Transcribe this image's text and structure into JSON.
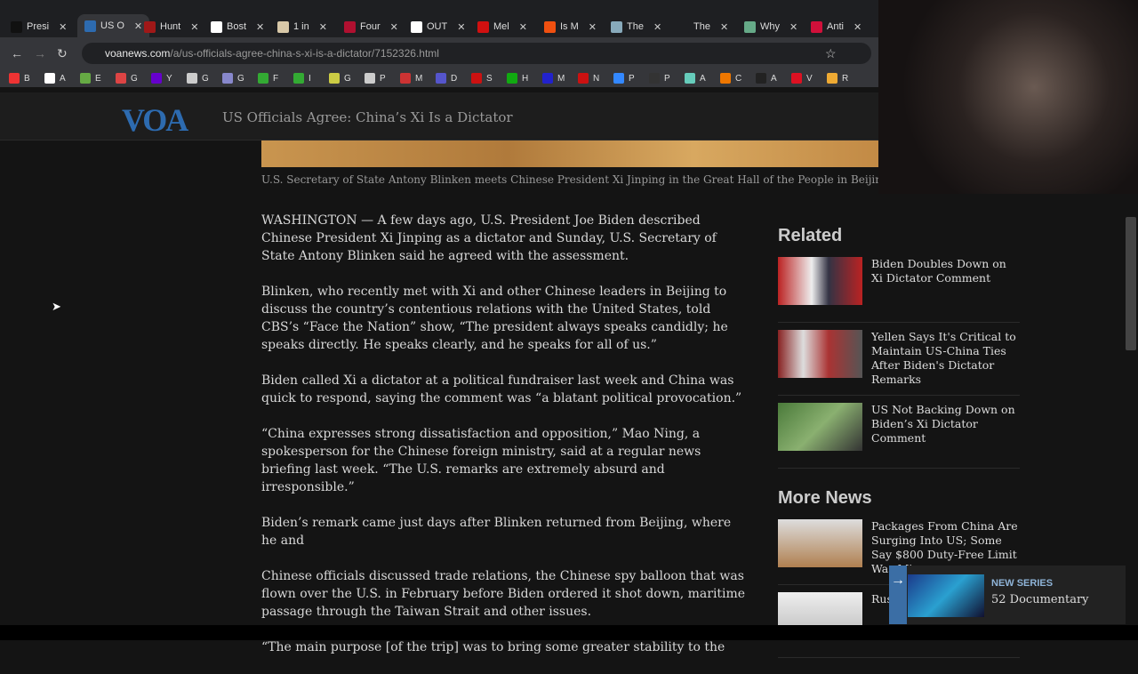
{
  "tabs": [
    {
      "label": "Presi",
      "color": "#111"
    },
    {
      "label": "US O",
      "color": "#2d6bb0",
      "active": true
    },
    {
      "label": "Hunt",
      "color": "#a01818"
    },
    {
      "label": "Bost",
      "color": "#fff"
    },
    {
      "label": "1 in",
      "color": "#d8c8a8"
    },
    {
      "label": "Four",
      "color": "#b01030"
    },
    {
      "label": "OUT",
      "color": "#fff"
    },
    {
      "label": "Mel",
      "color": "#d01010"
    },
    {
      "label": "Is M",
      "color": "#f05010"
    },
    {
      "label": "The",
      "color": "#8ab"
    },
    {
      "label": "The",
      "color": "#1e1f22"
    },
    {
      "label": "Why",
      "color": "#6a8"
    },
    {
      "label": "Anti",
      "color": "#d0103a"
    }
  ],
  "address": {
    "domain": "voanews.com",
    "path": "/a/us-officials-agree-china-s-xi-is-a-dictator/7152326.html"
  },
  "bookmarks": [
    {
      "l": "B",
      "c": "#e33"
    },
    {
      "l": "A",
      "c": "#fff"
    },
    {
      "l": "E",
      "c": "#6a4"
    },
    {
      "l": "G",
      "c": "#d44"
    },
    {
      "l": "Y",
      "c": "#60c"
    },
    {
      "l": "G",
      "c": "#ccc"
    },
    {
      "l": "G",
      "c": "#88c"
    },
    {
      "l": "F",
      "c": "#3a3"
    },
    {
      "l": "I",
      "c": "#3a3"
    },
    {
      "l": "G",
      "c": "#cc4"
    },
    {
      "l": "P",
      "c": "#ccc"
    },
    {
      "l": "M",
      "c": "#c33"
    },
    {
      "l": "D",
      "c": "#55c"
    },
    {
      "l": "S",
      "c": "#c11"
    },
    {
      "l": "H",
      "c": "#1a1"
    },
    {
      "l": "M",
      "c": "#22c"
    },
    {
      "l": "N",
      "c": "#c11"
    },
    {
      "l": "P",
      "c": "#38f"
    },
    {
      "l": "P",
      "c": "#333"
    },
    {
      "l": "A",
      "c": "#6cb"
    },
    {
      "l": "C",
      "c": "#e70"
    },
    {
      "l": "A",
      "c": "#222"
    },
    {
      "l": "V",
      "c": "#d12"
    },
    {
      "l": "R",
      "c": "#ea3"
    }
  ],
  "site": {
    "logo": "VOA",
    "title": "US Officials Agree: China’s Xi Is a Dictator"
  },
  "caption": "U.S. Secretary of State Antony Blinken meets Chinese President Xi Jinping in the Great Hall of the People in Beijing, China",
  "paragraphs": [
    "WASHINGTON — A few days ago, U.S. President Joe Biden described Chinese President Xi Jinping as a dictator and Sunday, U.S. Secretary of State Antony Blinken said he agreed with the assessment.",
    "Blinken, who recently met with Xi and other Chinese leaders in Beijing to discuss the country’s contentious relations with the United States, told CBS’s “Face the Nation” show, “The president always speaks candidly; he speaks directly. He speaks clearly, and he speaks for all of us.”",
    "Biden called Xi a dictator at a political fundraiser last week and China was quick to respond, saying the comment was “a blatant political provocation.”",
    "“China expresses strong dissatisfaction and opposition,” Mao Ning, a spokesperson for the Chinese foreign ministry, said at a regular news briefing last week. “The U.S. remarks are extremely absurd and irresponsible.”",
    "Biden’s remark came just days after Blinken returned from Beijing, where he and",
    "Chinese officials discussed trade relations, the Chinese spy balloon that was flown over the U.S. in February before Biden ordered it shot down, maritime passage through the Taiwan Strait and other issues.",
    "“The main purpose [of the trip] was to bring some greater stability to the"
  ],
  "related": {
    "heading": "Related",
    "items": [
      "Biden Doubles Down on Xi Dictator Comment",
      "Yellen Says It's Critical to Maintain US-China Ties After Biden's Dictator Remarks",
      "US Not Backing Down on Biden’s Xi Dictator Comment"
    ]
  },
  "more": {
    "heading": "More News",
    "items": [
      "Packages From China Are Surging Into US; Some Say $800 Duty-Free Limit Was Mis",
      "Rus to S"
    ]
  },
  "promo": {
    "kicker": "NEW SERIES",
    "title": "52 Documentary"
  }
}
